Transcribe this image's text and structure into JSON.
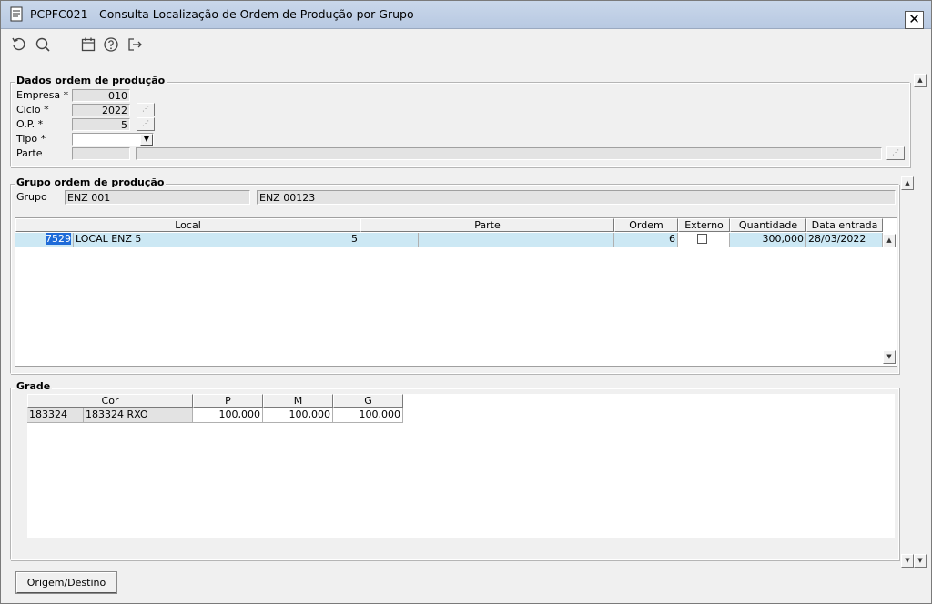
{
  "window": {
    "title": "PCPFC021 - Consulta Localização de Ordem de Produção por Grupo",
    "close_label": "✕"
  },
  "toolbar": {
    "icons": [
      "refresh-icon",
      "search-icon",
      "calendar-icon",
      "help-icon",
      "exit-icon"
    ]
  },
  "dados": {
    "title": "Dados ordem de produção",
    "empresa_label": "Empresa *",
    "empresa_value": "010",
    "ciclo_label": "Ciclo *",
    "ciclo_value": "2022",
    "op_label": "O.P. *",
    "op_value": "5",
    "tipo_label": "Tipo *",
    "tipo_value": "",
    "parte_label": "Parte",
    "parte_value": "",
    "parte_desc": ""
  },
  "grupo": {
    "title": "Grupo ordem de produção",
    "grupo_label": "Grupo",
    "grupo_code": "ENZ 001",
    "grupo_desc": "ENZ 00123"
  },
  "local_table": {
    "headers": [
      "Local",
      "Parte",
      "Ordem",
      "Externo",
      "Quantidade",
      "Data entrada"
    ],
    "rows": [
      {
        "local_code": "7529",
        "local_name": "LOCAL ENZ 5",
        "local_num": "5",
        "parte_code": "",
        "parte_desc": "",
        "ordem": "6",
        "externo": false,
        "quantidade": "300,000",
        "data_entrada": "28/03/2022"
      }
    ]
  },
  "grade": {
    "title": "Grade",
    "headers": [
      "Cor",
      "P",
      "M",
      "G"
    ],
    "rows": [
      {
        "cor_code": "183324",
        "cor_desc": "183324 RXO",
        "p": "100,000",
        "m": "100,000",
        "g": "100,000"
      }
    ]
  },
  "buttons": {
    "origem_destino": "Origem/Destino"
  }
}
